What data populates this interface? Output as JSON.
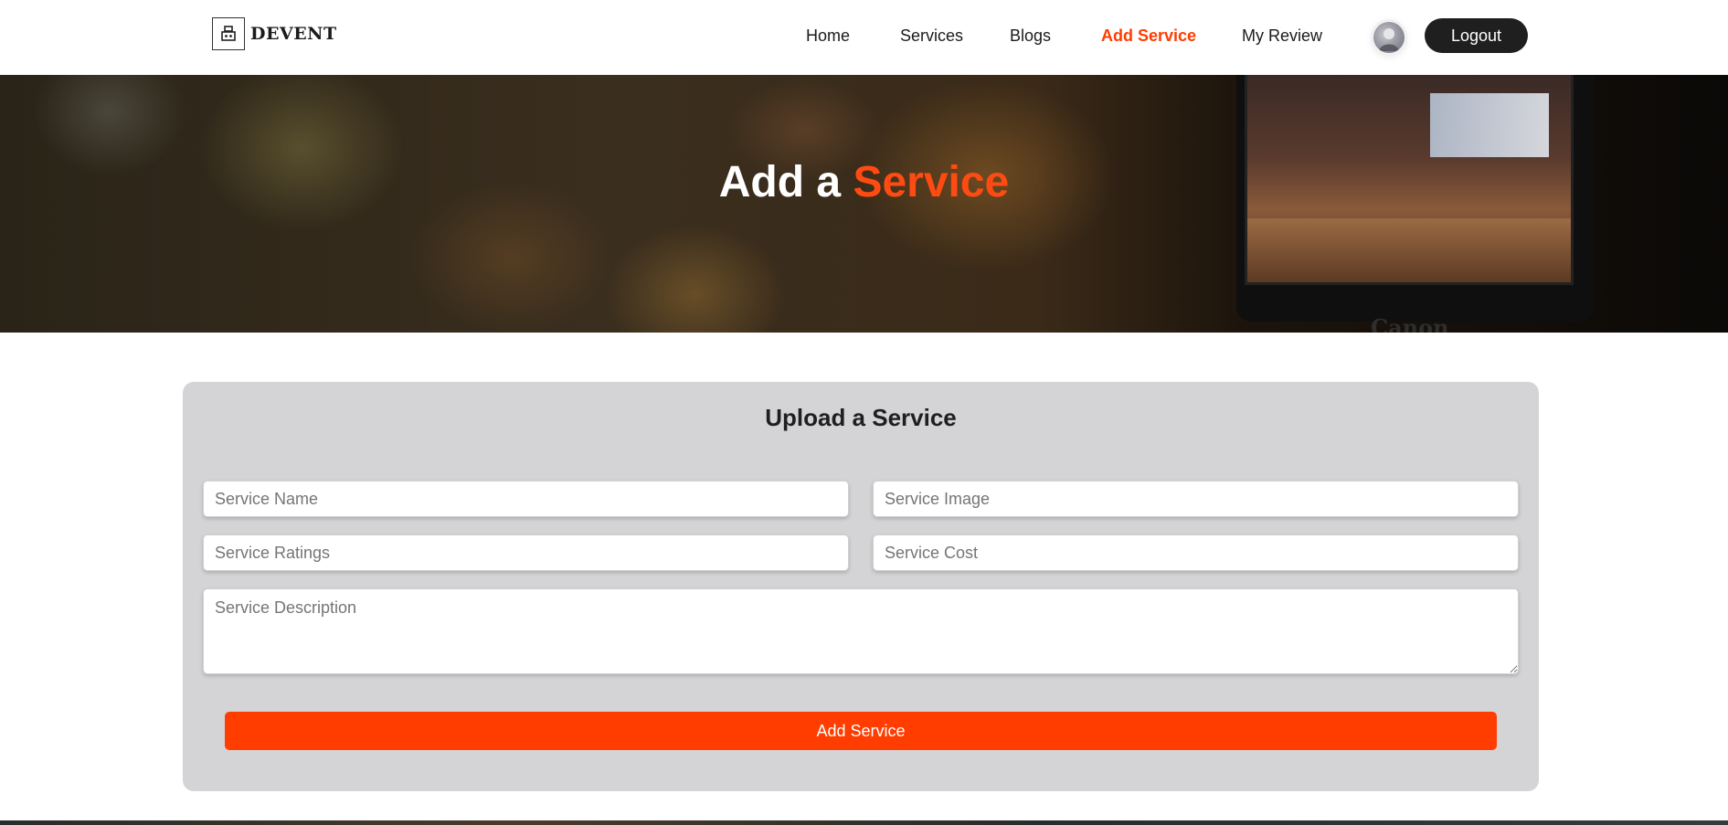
{
  "navbar": {
    "logo_text": "DEVENT",
    "links": [
      {
        "label": "Home",
        "active": false
      },
      {
        "label": "Services",
        "active": false
      },
      {
        "label": "Blogs",
        "active": false
      },
      {
        "label": "Add Service",
        "active": true
      },
      {
        "label": "My Review",
        "active": false
      }
    ],
    "logout_label": "Logout",
    "accent_color": "#ff3d00"
  },
  "hero": {
    "title_prefix": "Add a",
    "title_accent": "Service",
    "camera_brand": "Canon"
  },
  "form": {
    "title": "Upload a Service",
    "service_name_placeholder": "Service Name",
    "service_image_placeholder": "Service Image",
    "service_ratings_placeholder": "Service Ratings",
    "service_cost_placeholder": "Service Cost",
    "service_description_placeholder": "Service Description",
    "submit_label": "Add Service",
    "button_color": "#ff3d00"
  },
  "icons": {
    "logo": "robot-icon"
  }
}
